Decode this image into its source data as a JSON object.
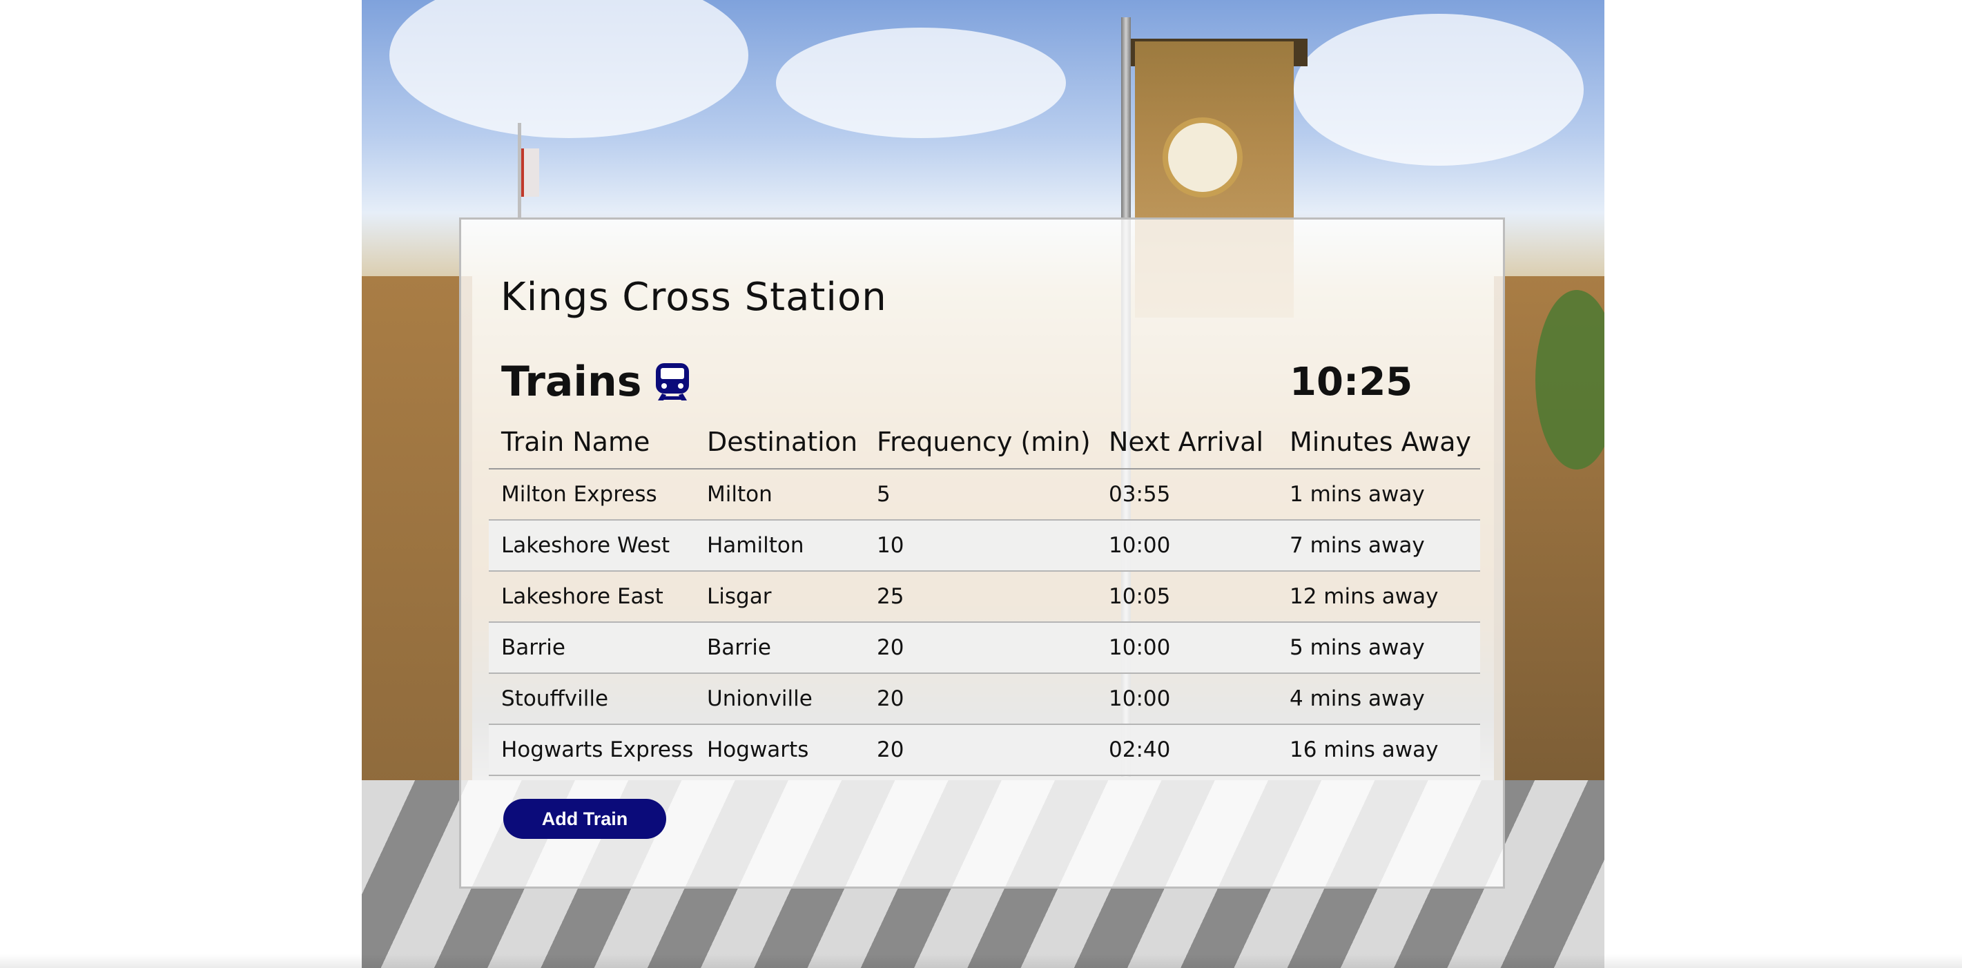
{
  "station": {
    "title": "Kings Cross Station"
  },
  "trains": {
    "heading": "Trains",
    "icon": "train-icon",
    "current_time": "10:25",
    "columns": [
      "Train Name",
      "Destination",
      "Frequency (min)",
      "Next Arrival",
      "Minutes Away"
    ],
    "rows": [
      [
        "Milton Express",
        "Milton",
        "5",
        "03:55",
        "1 mins away"
      ],
      [
        "Lakeshore West",
        "Hamilton",
        "10",
        "10:00",
        "7 mins away"
      ],
      [
        "Lakeshore East",
        "Lisgar",
        "25",
        "10:05",
        "12 mins away"
      ],
      [
        "Barrie",
        "Barrie",
        "20",
        "10:00",
        "5 mins away"
      ],
      [
        "Stouffville",
        "Unionville",
        "20",
        "10:00",
        "4 mins away"
      ],
      [
        "Hogwarts Express",
        "Hogwarts",
        "20",
        "02:40",
        "16 mins away"
      ]
    ]
  },
  "actions": {
    "add_train_label": "Add Train"
  },
  "colors": {
    "accent": "#0b0b7a",
    "icon": "#0b0b7a"
  }
}
